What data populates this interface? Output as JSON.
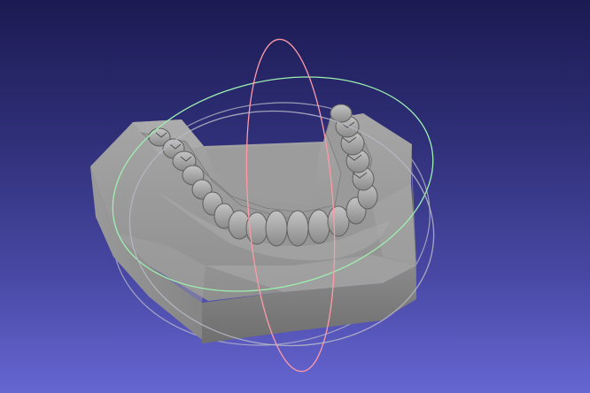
{
  "viewer": {
    "background_top": "#1c1a52",
    "background_bottom": "#6666d2"
  },
  "model": {
    "subject": "dental-arch-scan",
    "color": "#8e8e8e"
  },
  "trackball": {
    "x_ring_color": "#ff9aa8",
    "y_ring_color": "#9ef0b0",
    "z_ring_color": "#b8b8c8"
  }
}
